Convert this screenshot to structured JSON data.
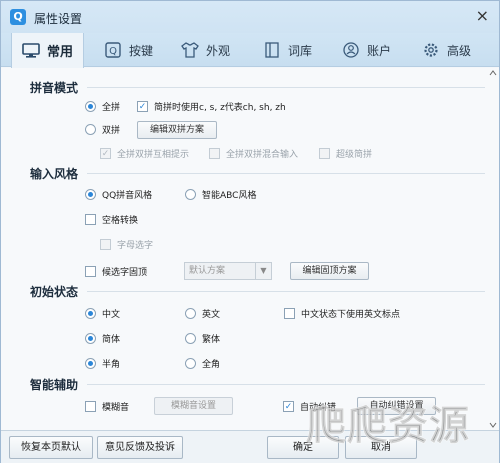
{
  "window": {
    "title": "属性设置",
    "logo": "Q",
    "close": "×"
  },
  "tabs": [
    {
      "label": "常用",
      "icon": "monitor-icon"
    },
    {
      "label": "按键",
      "icon": "key-icon"
    },
    {
      "label": "外观",
      "icon": "shirt-icon"
    },
    {
      "label": "词库",
      "icon": "book-icon"
    },
    {
      "label": "账户",
      "icon": "user-icon"
    },
    {
      "label": "高级",
      "icon": "gear-icon"
    }
  ],
  "pinyin_mode": {
    "title": "拼音模式",
    "full": "全拼",
    "jianpin_option": "简拼时使用c, s, z代表ch, sh, zh",
    "double": "双拼",
    "edit_double_btn": "编辑双拼方案",
    "double_hint": "全拼双拼互相提示",
    "double_mixed": "全拼双拼混合输入",
    "super_jianpin": "超级简拼"
  },
  "input_style": {
    "title": "输入风格",
    "qq_style": "QQ拼音风格",
    "abc_style": "智能ABC风格",
    "space_convert": "空格转换",
    "letter_select": "字母选字",
    "candidate_pin": "候选字固顶",
    "default_scheme": "默认方案",
    "edit_pin_btn": "编辑固顶方案"
  },
  "initial_state": {
    "title": "初始状态",
    "chinese": "中文",
    "english": "英文",
    "cn_en_punct": "中文状态下使用英文标点",
    "simplified": "简体",
    "traditional": "繁体",
    "half_width": "半角",
    "full_width": "全角"
  },
  "smart_assist": {
    "title": "智能辅助",
    "fuzzy": "模糊音",
    "fuzzy_settings_btn": "模糊音设置",
    "auto_correct": "自动纠错",
    "auto_correct_btn": "自动纠错设置"
  },
  "footer": {
    "restore": "恢复本页默认",
    "feedback": "意见反馈及投诉",
    "ok": "确定",
    "cancel": "取消"
  },
  "watermark": "爬爬资源",
  "colors": {
    "accent": "#2b86d8",
    "titlebar": "#d6e8f6"
  }
}
